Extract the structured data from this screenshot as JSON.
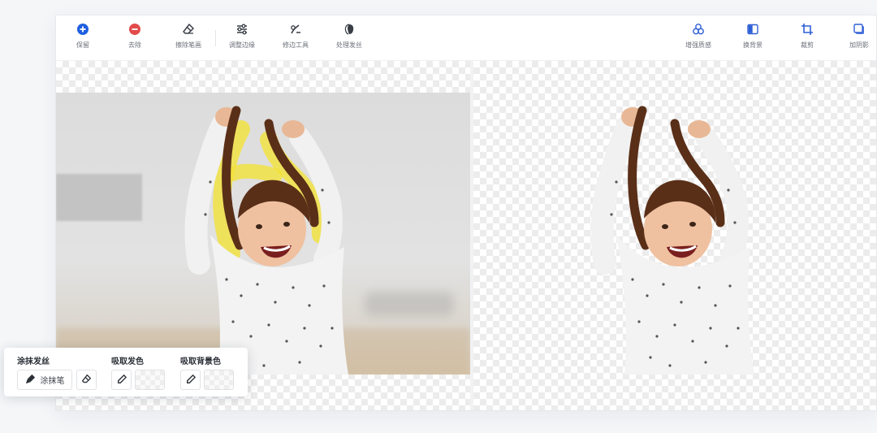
{
  "toolbar": {
    "left_tools": [
      {
        "label": "保留",
        "icon": "plus-circle-icon",
        "color": "#1f5fe0"
      },
      {
        "label": "去除",
        "icon": "minus-circle-icon",
        "color": "#e24b4b"
      },
      {
        "label": "擦除笔画",
        "icon": "eraser-icon",
        "color": "#3a3f47"
      },
      {
        "label": "调整边缘",
        "icon": "sliders-icon",
        "color": "#3a3f47"
      },
      {
        "label": "修边工具",
        "icon": "trim-brush-icon",
        "color": "#3a3f47"
      },
      {
        "label": "处理发丝",
        "icon": "hair-icon",
        "color": "#3a3f47"
      }
    ],
    "right_tools": [
      {
        "label": "增强质感",
        "icon": "enhance-icon",
        "color": "#2f5fd6"
      },
      {
        "label": "换背景",
        "icon": "background-swap-icon",
        "color": "#2f5fd6"
      },
      {
        "label": "裁剪",
        "icon": "crop-icon",
        "color": "#2f5fd6"
      },
      {
        "label": "加阴影",
        "icon": "shadow-icon",
        "color": "#2f5fd6"
      }
    ]
  },
  "hair_panel": {
    "section_brush": "涂抹发丝",
    "brush_label": "涂抹笔",
    "section_hair_color": "吸取发色",
    "section_bg_color": "吸取背景色"
  },
  "colors": {
    "accent": "#1f5fe0",
    "danger": "#e24b4b",
    "highlight": "#f2e23a"
  }
}
